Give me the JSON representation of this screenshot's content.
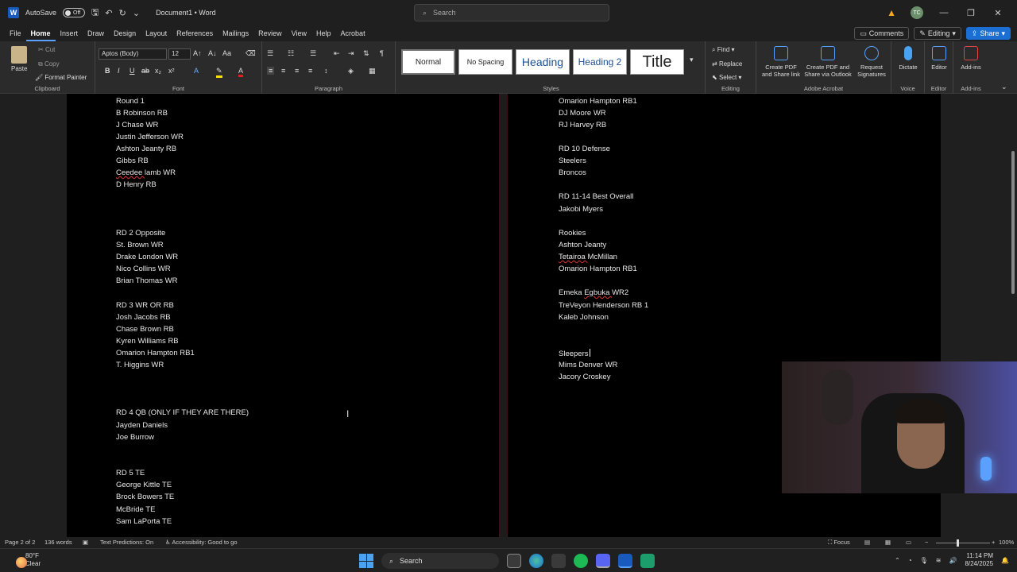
{
  "titlebar": {
    "autosave_label": "AutoSave",
    "autosave_state": "Off",
    "document_title": "Document1",
    "app_suffix": "• Word",
    "search_placeholder": "Search",
    "avatar_initials": "TC"
  },
  "menu": {
    "tabs": [
      "File",
      "Home",
      "Insert",
      "Draw",
      "Design",
      "Layout",
      "References",
      "Mailings",
      "Review",
      "View",
      "Help",
      "Acrobat"
    ],
    "active_tab": "Home",
    "comments": "Comments",
    "editing": "Editing",
    "share": "Share"
  },
  "ribbon": {
    "clipboard": {
      "paste": "Paste",
      "cut": "Cut",
      "copy": "Copy",
      "format_painter": "Format Painter",
      "label": "Clipboard"
    },
    "font": {
      "name": "Aptos (Body)",
      "size": "12",
      "label": "Font"
    },
    "paragraph": {
      "label": "Paragraph"
    },
    "styles": {
      "items": [
        "Normal",
        "No Spacing",
        "Heading",
        "Heading 2",
        "Title"
      ],
      "label": "Styles"
    },
    "editing": {
      "find": "Find",
      "replace": "Replace",
      "select": "Select",
      "label": "Editing"
    },
    "acrobat": {
      "create_pdf_share_link": "Create PDF and Share link",
      "create_pdf_outlook": "Create PDF and Share via Outlook",
      "request_signatures": "Request Signatures",
      "label": "Adobe Acrobat"
    },
    "voice": {
      "dictate": "Dictate",
      "label": "Voice"
    },
    "editor": {
      "editor": "Editor",
      "label": "Editor"
    },
    "addins": {
      "addins": "Add-ins",
      "label": "Add-ins"
    }
  },
  "document": {
    "left_page": [
      "Round 1",
      "B Robinson RB",
      "J Chase WR",
      "Justin Jefferson WR",
      "Ashton Jeanty RB",
      "Gibbs RB",
      "Ceedee lamb WR",
      "D Henry RB",
      "RD 2 Opposite",
      "St. Brown WR",
      "Drake London WR",
      "Nico Collins WR",
      "Brian Thomas WR",
      "RD 3 WR OR RB",
      "Josh Jacobs RB",
      "Chase Brown RB",
      "Kyren Williams RB",
      "Omarion Hampton  RB1",
      "T. Higgins WR",
      "RD 4 QB (ONLY IF THEY ARE THERE)",
      "Jayden Daniels",
      "Joe Burrow",
      "RD 5 TE",
      "George Kittle TE",
      "Brock Bowers TE",
      "McBride TE",
      "Sam LaPorta TE"
    ],
    "right_page": [
      "Omarion Hampton  RB1",
      "DJ Moore WR",
      "RJ Harvey RB",
      "RD 10  Defense",
      "Steelers",
      "Broncos",
      "RD 11-14 Best Overall",
      "Jakobi Myers",
      "Rookies",
      "Ashton Jeanty",
      "Tetairoa McMillan",
      "Omarion Hampton  RB1",
      "Emeka Egbuka WR2",
      "TreVeyon Henderson RB 1",
      "Kaleb Johnson",
      "Sleepers",
      "Mims Denver WR",
      "Jacory Croskey"
    ]
  },
  "statusbar": {
    "page": "Page 2 of 2",
    "words": "136 words",
    "predictions": "Text Predictions: On",
    "accessibility": "Accessibility: Good to go",
    "focus": "Focus",
    "zoom": "100%"
  },
  "taskbar": {
    "weather_temp": "80°F",
    "weather_desc": "Clear",
    "search": "Search",
    "time": "11:14 PM",
    "date": "8/24/2025"
  },
  "colors": {
    "accent": "#1b6fd3",
    "word": "#185abd",
    "warning": "#f5a623"
  }
}
